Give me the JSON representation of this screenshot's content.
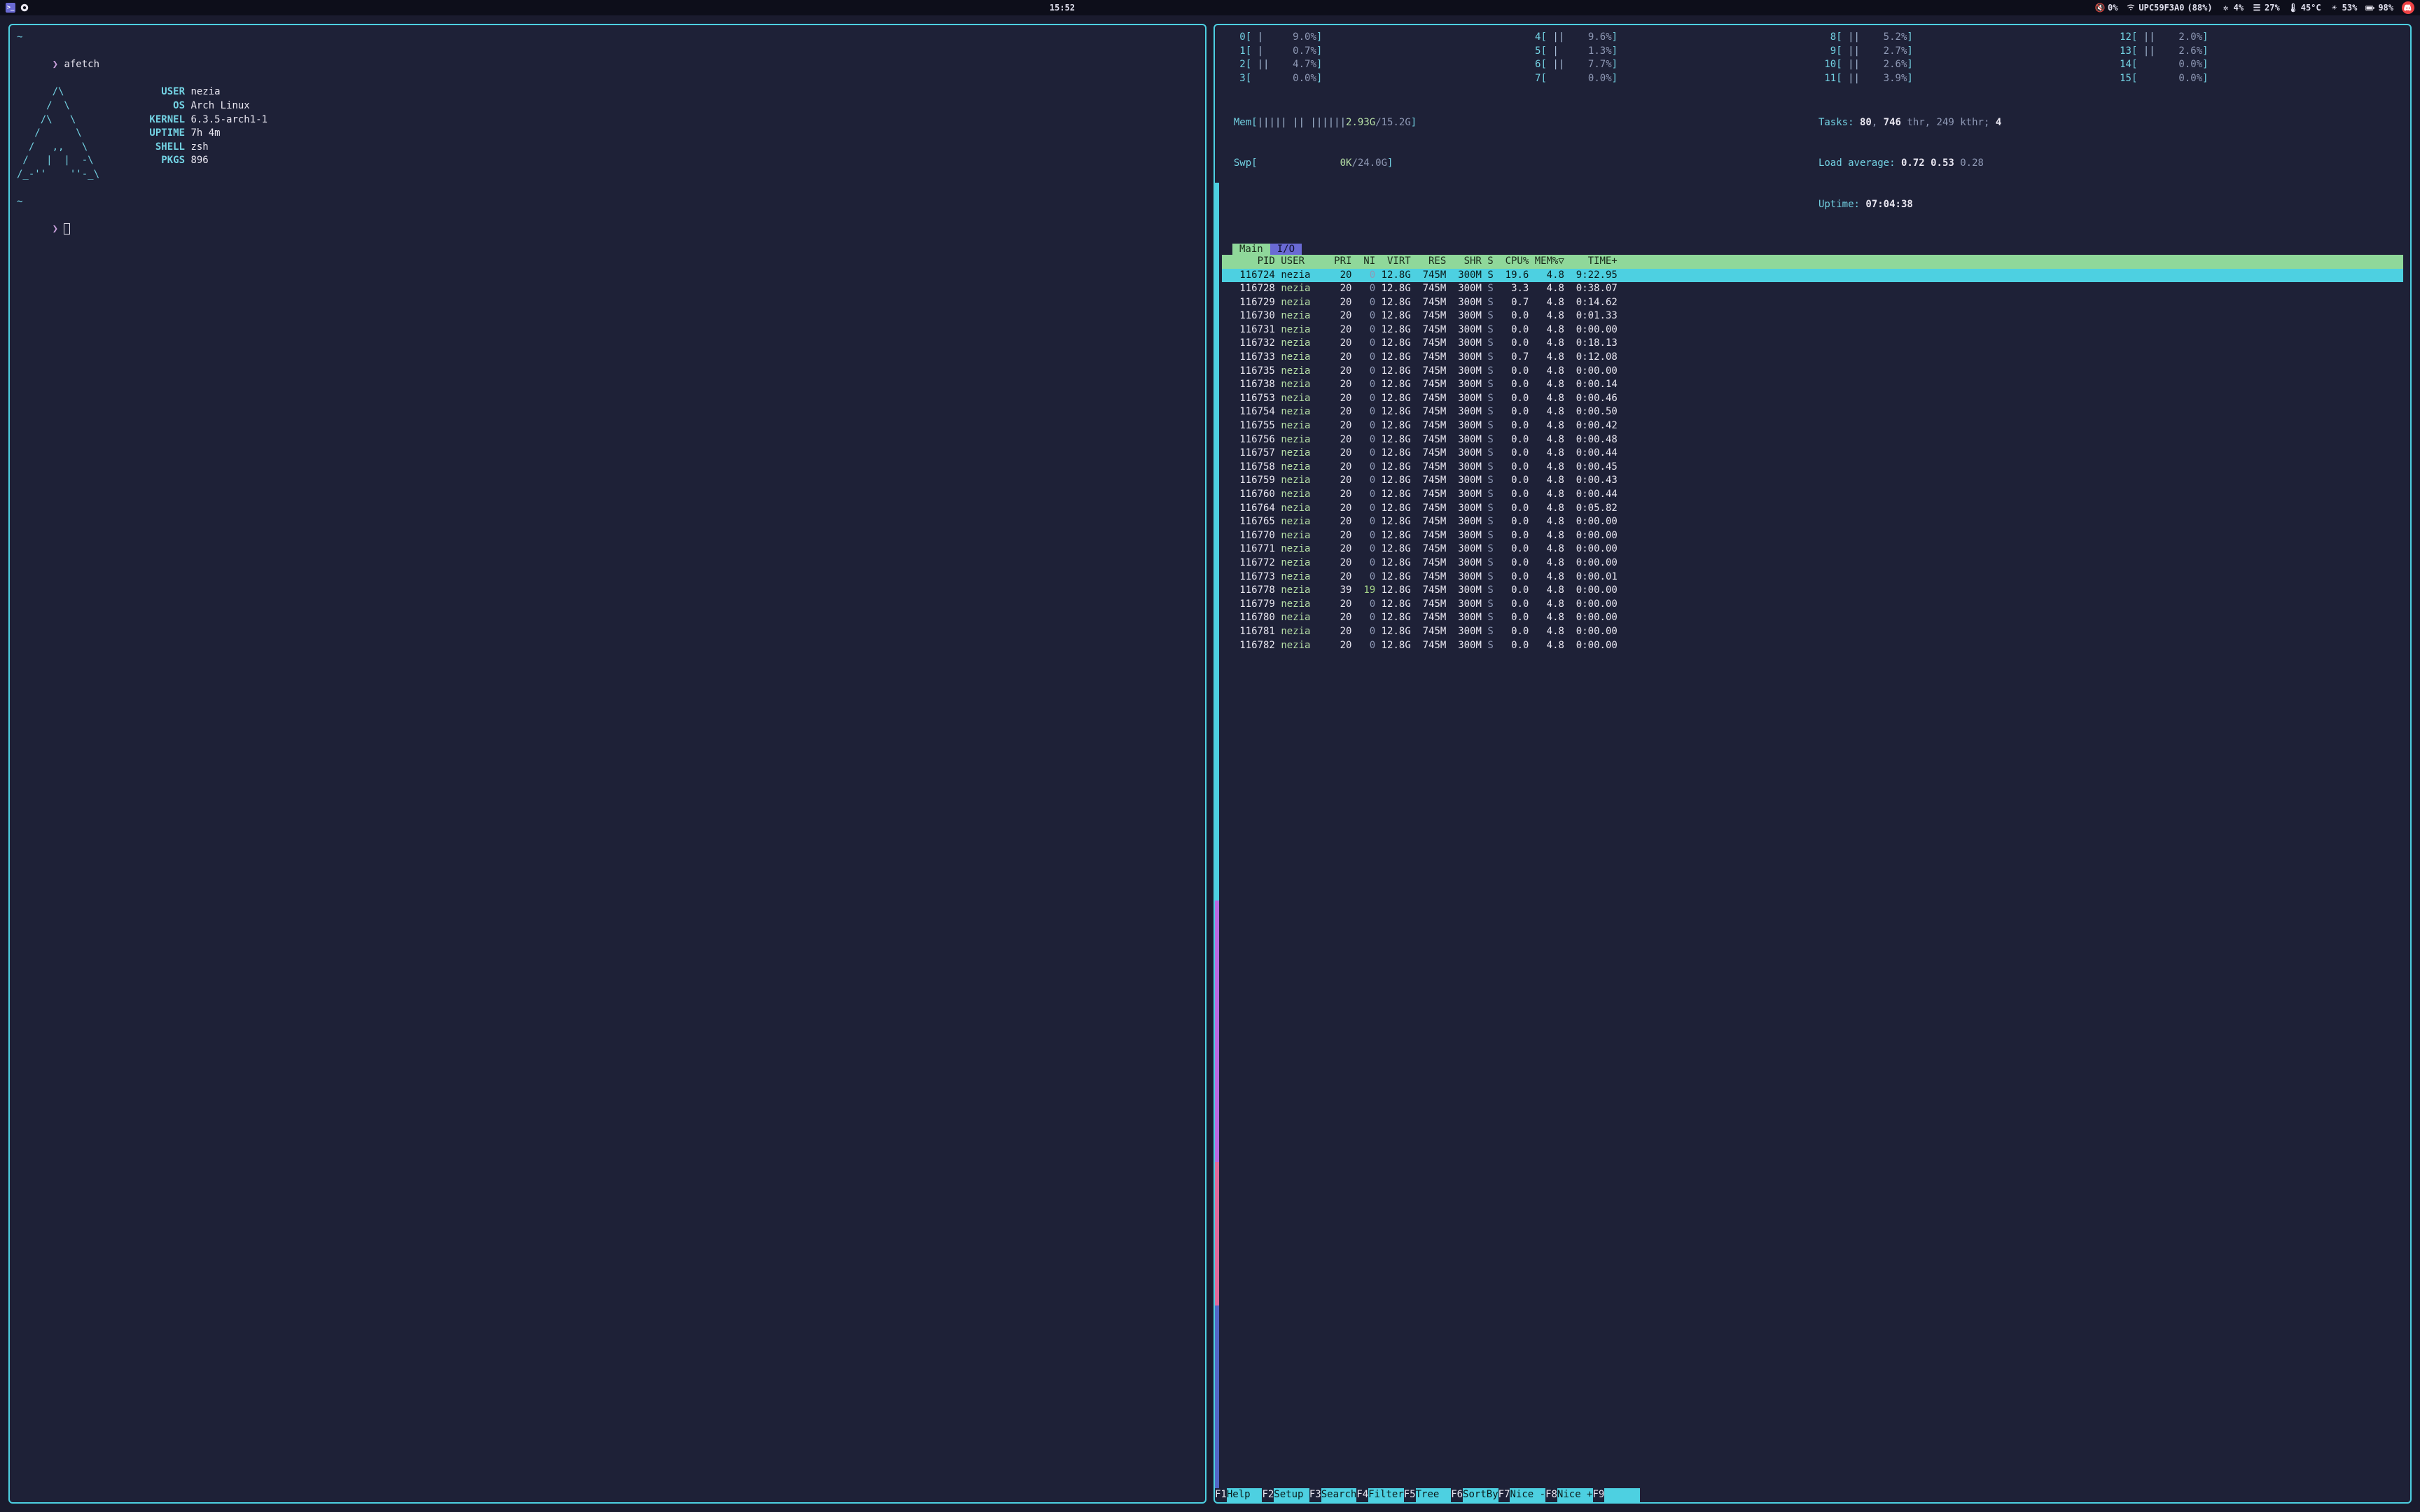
{
  "topbar": {
    "clock": "15:52",
    "volume_muted": true,
    "volume_pct": "0%",
    "wifi_ssid": "UPC59F3A0",
    "wifi_signal_pct": "(88%)",
    "gear_pct": "4%",
    "bars_pct": "27%",
    "temp": "45°C",
    "bright_pct": "53%",
    "battery_pct": "98%"
  },
  "afetch": {
    "cmd": "afetch",
    "ascii": "      /\\\n     /  \\\n    /\\   \\\n   /      \\\n  /   ,,   \\\n /   |  |  -\\\n/_-''    ''-_\\",
    "info": [
      {
        "label": "USER",
        "value": "nezia"
      },
      {
        "label": "OS",
        "value": "Arch Linux"
      },
      {
        "label": "KERNEL",
        "value": "6.3.5-arch1-1"
      },
      {
        "label": "UPTIME",
        "value": "7h 4m"
      },
      {
        "label": "SHELL",
        "value": "zsh"
      },
      {
        "label": "PKGS",
        "value": "896"
      }
    ]
  },
  "htop": {
    "cpus": [
      {
        "n": 0,
        "bar": "|",
        "pct": "9.0%"
      },
      {
        "n": 1,
        "bar": "|",
        "pct": "0.7%"
      },
      {
        "n": 2,
        "bar": "||",
        "pct": "4.7%"
      },
      {
        "n": 3,
        "bar": "",
        "pct": "0.0%"
      },
      {
        "n": 4,
        "bar": "||",
        "pct": "9.6%"
      },
      {
        "n": 5,
        "bar": "|",
        "pct": "1.3%"
      },
      {
        "n": 6,
        "bar": "||",
        "pct": "7.7%"
      },
      {
        "n": 7,
        "bar": "",
        "pct": "0.0%"
      },
      {
        "n": 8,
        "bar": "||",
        "pct": "5.2%"
      },
      {
        "n": 9,
        "bar": "||",
        "pct": "2.7%"
      },
      {
        "n": 10,
        "bar": "||",
        "pct": "2.6%"
      },
      {
        "n": 11,
        "bar": "||",
        "pct": "3.9%"
      },
      {
        "n": 12,
        "bar": "||",
        "pct": "2.0%"
      },
      {
        "n": 13,
        "bar": "||",
        "pct": "2.6%"
      },
      {
        "n": 14,
        "bar": "",
        "pct": "0.0%"
      },
      {
        "n": 15,
        "bar": "",
        "pct": "0.0%"
      }
    ],
    "mem": {
      "label": "Mem",
      "bar": "||||| || ||||||",
      "used": "2.93G",
      "total": "15.2G"
    },
    "swap": {
      "label": "Swp",
      "bar": "",
      "used": "0K",
      "total": "24.0G"
    },
    "tasks": {
      "procs": "80",
      "threads": "746",
      "kthreads": "249",
      "running": "4"
    },
    "load": {
      "a": "0.72",
      "b": "0.53",
      "c": "0.28"
    },
    "uptime": "07:04:38",
    "tabs": {
      "active": "Main",
      "inactive": "I/O"
    },
    "columns": [
      "PID",
      "USER",
      "PRI",
      "NI",
      "VIRT",
      "RES",
      "SHR",
      "S",
      "CPU%",
      "MEM%▽",
      "TIME+"
    ],
    "processes": [
      {
        "pid": "116724",
        "user": "nezia",
        "pri": "20",
        "ni": "0",
        "virt": "12.8G",
        "res": "745M",
        "shr": "300M",
        "s": "S",
        "cpu": "19.6",
        "mem": "4.8",
        "time": "9:22.95",
        "selected": true
      },
      {
        "pid": "116728",
        "user": "nezia",
        "pri": "20",
        "ni": "0",
        "virt": "12.8G",
        "res": "745M",
        "shr": "300M",
        "s": "S",
        "cpu": "3.3",
        "mem": "4.8",
        "time": "0:38.07"
      },
      {
        "pid": "116729",
        "user": "nezia",
        "pri": "20",
        "ni": "0",
        "virt": "12.8G",
        "res": "745M",
        "shr": "300M",
        "s": "S",
        "cpu": "0.7",
        "mem": "4.8",
        "time": "0:14.62"
      },
      {
        "pid": "116730",
        "user": "nezia",
        "pri": "20",
        "ni": "0",
        "virt": "12.8G",
        "res": "745M",
        "shr": "300M",
        "s": "S",
        "cpu": "0.0",
        "mem": "4.8",
        "time": "0:01.33"
      },
      {
        "pid": "116731",
        "user": "nezia",
        "pri": "20",
        "ni": "0",
        "virt": "12.8G",
        "res": "745M",
        "shr": "300M",
        "s": "S",
        "cpu": "0.0",
        "mem": "4.8",
        "time": "0:00.00"
      },
      {
        "pid": "116732",
        "user": "nezia",
        "pri": "20",
        "ni": "0",
        "virt": "12.8G",
        "res": "745M",
        "shr": "300M",
        "s": "S",
        "cpu": "0.0",
        "mem": "4.8",
        "time": "0:18.13"
      },
      {
        "pid": "116733",
        "user": "nezia",
        "pri": "20",
        "ni": "0",
        "virt": "12.8G",
        "res": "745M",
        "shr": "300M",
        "s": "S",
        "cpu": "0.7",
        "mem": "4.8",
        "time": "0:12.08"
      },
      {
        "pid": "116735",
        "user": "nezia",
        "pri": "20",
        "ni": "0",
        "virt": "12.8G",
        "res": "745M",
        "shr": "300M",
        "s": "S",
        "cpu": "0.0",
        "mem": "4.8",
        "time": "0:00.00"
      },
      {
        "pid": "116738",
        "user": "nezia",
        "pri": "20",
        "ni": "0",
        "virt": "12.8G",
        "res": "745M",
        "shr": "300M",
        "s": "S",
        "cpu": "0.0",
        "mem": "4.8",
        "time": "0:00.14"
      },
      {
        "pid": "116753",
        "user": "nezia",
        "pri": "20",
        "ni": "0",
        "virt": "12.8G",
        "res": "745M",
        "shr": "300M",
        "s": "S",
        "cpu": "0.0",
        "mem": "4.8",
        "time": "0:00.46"
      },
      {
        "pid": "116754",
        "user": "nezia",
        "pri": "20",
        "ni": "0",
        "virt": "12.8G",
        "res": "745M",
        "shr": "300M",
        "s": "S",
        "cpu": "0.0",
        "mem": "4.8",
        "time": "0:00.50"
      },
      {
        "pid": "116755",
        "user": "nezia",
        "pri": "20",
        "ni": "0",
        "virt": "12.8G",
        "res": "745M",
        "shr": "300M",
        "s": "S",
        "cpu": "0.0",
        "mem": "4.8",
        "time": "0:00.42"
      },
      {
        "pid": "116756",
        "user": "nezia",
        "pri": "20",
        "ni": "0",
        "virt": "12.8G",
        "res": "745M",
        "shr": "300M",
        "s": "S",
        "cpu": "0.0",
        "mem": "4.8",
        "time": "0:00.48"
      },
      {
        "pid": "116757",
        "user": "nezia",
        "pri": "20",
        "ni": "0",
        "virt": "12.8G",
        "res": "745M",
        "shr": "300M",
        "s": "S",
        "cpu": "0.0",
        "mem": "4.8",
        "time": "0:00.44"
      },
      {
        "pid": "116758",
        "user": "nezia",
        "pri": "20",
        "ni": "0",
        "virt": "12.8G",
        "res": "745M",
        "shr": "300M",
        "s": "S",
        "cpu": "0.0",
        "mem": "4.8",
        "time": "0:00.45"
      },
      {
        "pid": "116759",
        "user": "nezia",
        "pri": "20",
        "ni": "0",
        "virt": "12.8G",
        "res": "745M",
        "shr": "300M",
        "s": "S",
        "cpu": "0.0",
        "mem": "4.8",
        "time": "0:00.43"
      },
      {
        "pid": "116760",
        "user": "nezia",
        "pri": "20",
        "ni": "0",
        "virt": "12.8G",
        "res": "745M",
        "shr": "300M",
        "s": "S",
        "cpu": "0.0",
        "mem": "4.8",
        "time": "0:00.44"
      },
      {
        "pid": "116764",
        "user": "nezia",
        "pri": "20",
        "ni": "0",
        "virt": "12.8G",
        "res": "745M",
        "shr": "300M",
        "s": "S",
        "cpu": "0.0",
        "mem": "4.8",
        "time": "0:05.82"
      },
      {
        "pid": "116765",
        "user": "nezia",
        "pri": "20",
        "ni": "0",
        "virt": "12.8G",
        "res": "745M",
        "shr": "300M",
        "s": "S",
        "cpu": "0.0",
        "mem": "4.8",
        "time": "0:00.00"
      },
      {
        "pid": "116770",
        "user": "nezia",
        "pri": "20",
        "ni": "0",
        "virt": "12.8G",
        "res": "745M",
        "shr": "300M",
        "s": "S",
        "cpu": "0.0",
        "mem": "4.8",
        "time": "0:00.00"
      },
      {
        "pid": "116771",
        "user": "nezia",
        "pri": "20",
        "ni": "0",
        "virt": "12.8G",
        "res": "745M",
        "shr": "300M",
        "s": "S",
        "cpu": "0.0",
        "mem": "4.8",
        "time": "0:00.00"
      },
      {
        "pid": "116772",
        "user": "nezia",
        "pri": "20",
        "ni": "0",
        "virt": "12.8G",
        "res": "745M",
        "shr": "300M",
        "s": "S",
        "cpu": "0.0",
        "mem": "4.8",
        "time": "0:00.00"
      },
      {
        "pid": "116773",
        "user": "nezia",
        "pri": "20",
        "ni": "0",
        "virt": "12.8G",
        "res": "745M",
        "shr": "300M",
        "s": "S",
        "cpu": "0.0",
        "mem": "4.8",
        "time": "0:00.01"
      },
      {
        "pid": "116778",
        "user": "nezia",
        "pri": "39",
        "ni": "19",
        "virt": "12.8G",
        "res": "745M",
        "shr": "300M",
        "s": "S",
        "cpu": "0.0",
        "mem": "4.8",
        "time": "0:00.00"
      },
      {
        "pid": "116779",
        "user": "nezia",
        "pri": "20",
        "ni": "0",
        "virt": "12.8G",
        "res": "745M",
        "shr": "300M",
        "s": "S",
        "cpu": "0.0",
        "mem": "4.8",
        "time": "0:00.00"
      },
      {
        "pid": "116780",
        "user": "nezia",
        "pri": "20",
        "ni": "0",
        "virt": "12.8G",
        "res": "745M",
        "shr": "300M",
        "s": "S",
        "cpu": "0.0",
        "mem": "4.8",
        "time": "0:00.00"
      },
      {
        "pid": "116781",
        "user": "nezia",
        "pri": "20",
        "ni": "0",
        "virt": "12.8G",
        "res": "745M",
        "shr": "300M",
        "s": "S",
        "cpu": "0.0",
        "mem": "4.8",
        "time": "0:00.00"
      },
      {
        "pid": "116782",
        "user": "nezia",
        "pri": "20",
        "ni": "0",
        "virt": "12.8G",
        "res": "745M",
        "shr": "300M",
        "s": "S",
        "cpu": "0.0",
        "mem": "4.8",
        "time": "0:00.00"
      }
    ],
    "fnkeys": [
      {
        "key": "F1",
        "label": "Help"
      },
      {
        "key": "F2",
        "label": "Setup"
      },
      {
        "key": "F3",
        "label": "Search"
      },
      {
        "key": "F4",
        "label": "Filter"
      },
      {
        "key": "F5",
        "label": "Tree"
      },
      {
        "key": "F6",
        "label": "SortBy"
      },
      {
        "key": "F7",
        "label": "Nice -"
      },
      {
        "key": "F8",
        "label": "Nice +"
      },
      {
        "key": "F9",
        "label": ""
      }
    ]
  }
}
